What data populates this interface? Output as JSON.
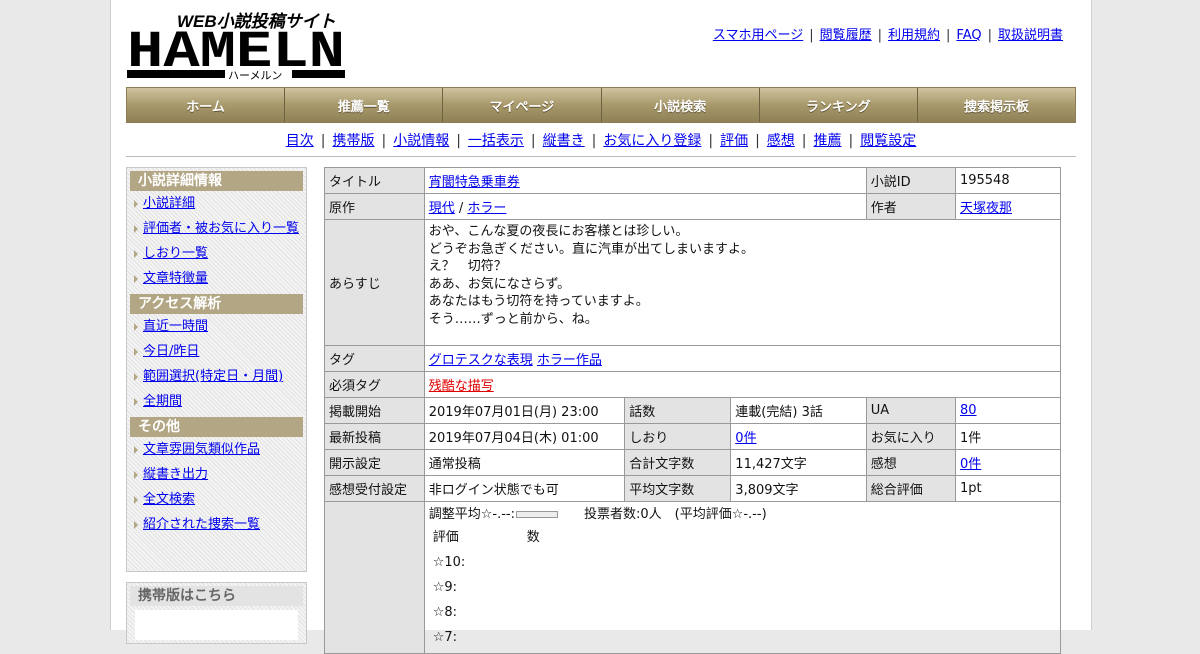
{
  "header": {
    "logo_tagline": "WEB小説投稿サイト",
    "logo_main": "HAMELN",
    "logo_kana": "ハーメルン",
    "links": [
      "スマホ用ページ",
      "閲覧履歴",
      "利用規約",
      "FAQ",
      "取扱説明書"
    ],
    "separator": "|"
  },
  "mainnav": [
    "ホーム",
    "推薦一覧",
    "マイページ",
    "小説検索",
    "ランキング",
    "捜索掲示板"
  ],
  "subnav": [
    "目次",
    "携帯版",
    "小説情報",
    "一括表示",
    "縦書き",
    "お気に入り登録",
    "評価",
    "感想",
    "推薦",
    "閲覧設定"
  ],
  "sidebar": {
    "sections": [
      {
        "title": "小説詳細情報",
        "items": [
          "小説詳細",
          "評価者・被お気に入り一覧",
          "しおり一覧",
          "文章特徴量"
        ]
      },
      {
        "title": "アクセス解析",
        "items": [
          "直近一時間",
          "今日/昨日",
          "範囲選択(特定日・月間)",
          "全期間"
        ]
      },
      {
        "title": "その他",
        "items": [
          "文章雰囲気類似作品",
          "縦書き出力",
          "全文検索",
          "紹介された捜索一覧"
        ]
      }
    ],
    "mobile_title": "携帯版はこちら"
  },
  "info": {
    "title_label": "タイトル",
    "title": "宵闇特急乗車券",
    "id_label": "小説ID",
    "id": "195548",
    "original_label": "原作",
    "original_a": "現代",
    "original_sep": " / ",
    "original_b": "ホラー",
    "author_label": "作者",
    "author": "天塚夜那",
    "summary_label": "あらすじ",
    "summary": "おや、こんな夏の夜長にお客様とは珍しい。\nどうぞお急ぎください。直に汽車が出てしまいますよ。\nえ？　切符？\nああ、お気になさらず。\nあなたはもう切符を持っていますよ。\nそう……ずっと前から、ね。",
    "tags_label": "タグ",
    "tag1": "グロテスクな表現",
    "tag2": "ホラー作品",
    "req_tags_label": "必須タグ",
    "req_tag": "残酷な描写",
    "start_label": "掲載開始",
    "start": "2019年07月01日(月) 23:00",
    "episodes_label": "話数",
    "episodes": "連載(完結) 3話",
    "ua_label": "UA",
    "ua": "80",
    "latest_label": "最新投稿",
    "latest": "2019年07月04日(木) 01:00",
    "bookmarks_label": "しおり",
    "bookmarks": "0件",
    "fav_label": "お気に入り",
    "fav": "1件",
    "disclosure_label": "開示設定",
    "disclosure": "通常投稿",
    "total_chars_label": "合計文字数",
    "total_chars": "11,427文字",
    "comments_label": "感想",
    "comments": "0件",
    "reception_label": "感想受付設定",
    "reception": "非ログイン状態でも可",
    "avg_chars_label": "平均文字数",
    "avg_chars": "3,809文字",
    "overall_label": "総合評価",
    "overall": "1pt",
    "vote_summary_a": "調整平均☆-.--:",
    "vote_summary_b": "投票者数:0人　(平均評価☆-.--)",
    "vote_col1": "評価",
    "vote_col2": "数",
    "vote_rows": [
      "☆10:",
      "☆9:",
      "☆8:",
      "☆7:"
    ]
  }
}
